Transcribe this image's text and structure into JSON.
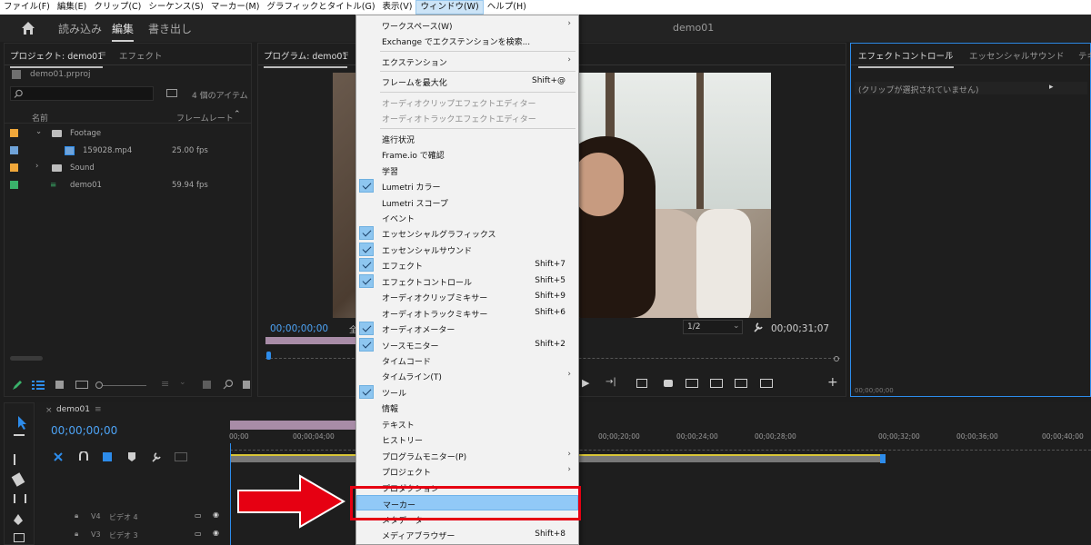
{
  "menubar": {
    "items": [
      "ファイル(F)",
      "編集(E)",
      "クリップ(C)",
      "シーケンス(S)",
      "マーカー(M)",
      "グラフィックとタイトル(G)",
      "表示(V)",
      "ウィンドウ(W)",
      "ヘルプ(H)"
    ],
    "active_index": 7
  },
  "workspace": {
    "tabs": [
      "読み込み",
      "編集",
      "書き出し"
    ],
    "active_tab": "編集",
    "document_title": "demo01"
  },
  "project_panel": {
    "tab_project": "プロジェクト: demo01",
    "tab_effects": "エフェクト",
    "file": "demo01.prproj",
    "item_count": "4 個のアイテム",
    "col_name": "名前",
    "col_framerate": "フレームレート",
    "rows": [
      {
        "name": "Footage",
        "fps": "",
        "color": "#f0a73a",
        "kind": "folder"
      },
      {
        "name": "159028.mp4",
        "fps": "25.00 fps",
        "color": "#6fa3d9",
        "kind": "clip"
      },
      {
        "name": "Sound",
        "fps": "",
        "color": "#f0a73a",
        "kind": "folder"
      },
      {
        "name": "demo01",
        "fps": "59.94 fps",
        "color": "#3ab26b",
        "kind": "sequence"
      }
    ]
  },
  "program_monitor": {
    "tab": "プログラム: demo01",
    "timecode_left": "00;00;00;00",
    "fit_label": "全",
    "zoom": "1/2",
    "timecode_right": "00;00;31;07"
  },
  "effect_controls": {
    "tab_effect_controls": "エフェクトコントロール",
    "tab_essential_sound": "エッセンシャルサウンド",
    "tab_more": "テキ",
    "no_clip": "(クリップが選択されていません)",
    "timecode": "00;00;00;00"
  },
  "timeline": {
    "tab": "demo01",
    "timecode": "00;00;00;00",
    "ruler_labels": [
      "00;00",
      "00;00;04;00",
      "00;00;20;00",
      "00;00;24;00",
      "00;00;28;00",
      "00;00;32;00",
      "00;00;36;00",
      "00;00;40;00"
    ],
    "tracks": [
      {
        "id": "V4",
        "name": "ビデオ 4"
      },
      {
        "id": "V3",
        "name": "ビデオ 3"
      }
    ]
  },
  "window_menu": {
    "items": [
      {
        "label": "ワークスペース(W)",
        "submenu": true
      },
      {
        "label": "Exchange でエクステンションを検索..."
      },
      {
        "sep": true
      },
      {
        "label": "エクステンション",
        "submenu": true
      },
      {
        "sep": true
      },
      {
        "label": "フレームを最大化",
        "shortcut": "Shift+@"
      },
      {
        "sep": true
      },
      {
        "label": "オーディオクリップエフェクトエディター",
        "disabled": true
      },
      {
        "label": "オーディオトラックエフェクトエディター",
        "disabled": true
      },
      {
        "sep": true
      },
      {
        "label": "進行状況"
      },
      {
        "label": "Frame.io で確認"
      },
      {
        "label": "学習"
      },
      {
        "label": "Lumetri カラー",
        "checked": true
      },
      {
        "label": "Lumetri スコープ"
      },
      {
        "label": "イベント"
      },
      {
        "label": "エッセンシャルグラフィックス",
        "checked": true
      },
      {
        "label": "エッセンシャルサウンド",
        "checked": true
      },
      {
        "label": "エフェクト",
        "checked": true,
        "shortcut": "Shift+7"
      },
      {
        "label": "エフェクトコントロール",
        "checked": true,
        "shortcut": "Shift+5"
      },
      {
        "label": "オーディオクリップミキサー",
        "shortcut": "Shift+9"
      },
      {
        "label": "オーディオトラックミキサー",
        "shortcut": "Shift+6"
      },
      {
        "label": "オーディオメーター",
        "checked": true
      },
      {
        "label": "ソースモニター",
        "checked": true,
        "shortcut": "Shift+2"
      },
      {
        "label": "タイムコード"
      },
      {
        "label": "タイムライン(T)",
        "submenu": true
      },
      {
        "label": "ツール",
        "checked": true
      },
      {
        "label": "情報"
      },
      {
        "label": "テキスト"
      },
      {
        "label": "ヒストリー"
      },
      {
        "label": "プログラムモニター(P)",
        "submenu": true
      },
      {
        "label": "プロジェクト",
        "submenu": true
      },
      {
        "label": "プロダクション"
      },
      {
        "label": "マーカー",
        "highlighted": true
      },
      {
        "label": "メタデータ"
      },
      {
        "label": "メディアブラウザー",
        "shortcut": "Shift+8"
      }
    ]
  },
  "colors": {
    "accent_blue": "#2d8ceb",
    "highlight_red": "#e60012",
    "menu_highlight": "#91c9f7"
  }
}
